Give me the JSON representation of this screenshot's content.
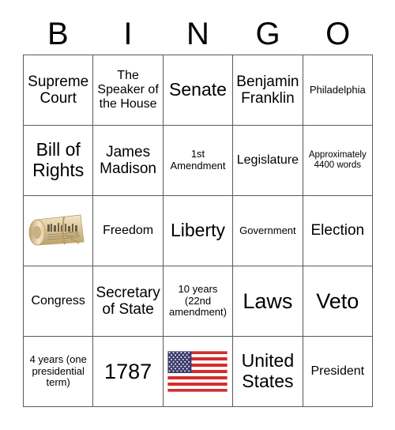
{
  "card": {
    "title": "BINGO",
    "header_letters": [
      "B",
      "I",
      "N",
      "G",
      "O"
    ],
    "grid": {
      "rows": 5,
      "columns": 5,
      "border_color": "#5a5a5a",
      "background_color": "#ffffff",
      "text_color": "#000000"
    },
    "cells": [
      [
        {
          "text": "Supreme Court",
          "size": "lg",
          "type": "text"
        },
        {
          "text": "The Speaker of the House",
          "size": "md",
          "type": "text"
        },
        {
          "text": "Senate",
          "size": "xl",
          "type": "text"
        },
        {
          "text": "Benjamin Franklin",
          "size": "lg",
          "type": "text"
        },
        {
          "text": "Philadelphia",
          "size": "sm",
          "type": "text"
        }
      ],
      [
        {
          "text": "Bill of Rights",
          "size": "xl",
          "type": "text"
        },
        {
          "text": "James Madison",
          "size": "lg",
          "type": "text"
        },
        {
          "text": "1st Amendment",
          "size": "sm",
          "type": "text"
        },
        {
          "text": "Legislature",
          "size": "md",
          "type": "text"
        },
        {
          "text": "Approximately 4400 words",
          "size": "xs",
          "type": "text"
        }
      ],
      [
        {
          "text": "",
          "size": "md",
          "type": "image",
          "icon": "rolled-parchment-scroll-icon",
          "alt": "Rolled parchment scroll tied with twine"
        },
        {
          "text": "Freedom",
          "size": "md",
          "type": "text"
        },
        {
          "text": "Liberty",
          "size": "xl",
          "type": "text"
        },
        {
          "text": "Government",
          "size": "sm",
          "type": "text"
        },
        {
          "text": "Election",
          "size": "lg",
          "type": "text"
        }
      ],
      [
        {
          "text": "Congress",
          "size": "md",
          "type": "text"
        },
        {
          "text": "Secretary of State",
          "size": "lg",
          "type": "text"
        },
        {
          "text": "10 years (22nd amendment)",
          "size": "sm",
          "type": "text"
        },
        {
          "text": "Laws",
          "size": "xxl",
          "type": "text"
        },
        {
          "text": "Veto",
          "size": "xxl",
          "type": "text"
        }
      ],
      [
        {
          "text": "4 years (one presidential term)",
          "size": "sm",
          "type": "text"
        },
        {
          "text": "1787",
          "size": "xxl",
          "type": "text"
        },
        {
          "text": "",
          "size": "md",
          "type": "image",
          "icon": "united-states-flag-icon",
          "alt": "Flag of the United States"
        },
        {
          "text": "United States",
          "size": "xl",
          "type": "text"
        },
        {
          "text": "President",
          "size": "md",
          "type": "text"
        }
      ]
    ],
    "colors": {
      "flag_blue": "#3c3b6e",
      "flag_red": "#d62b2b",
      "flag_white": "#ffffff",
      "scroll_light": "#f2e6c8",
      "scroll_mid": "#ddc79a",
      "scroll_dark": "#b99f6b",
      "twine": "#b39a63"
    }
  }
}
